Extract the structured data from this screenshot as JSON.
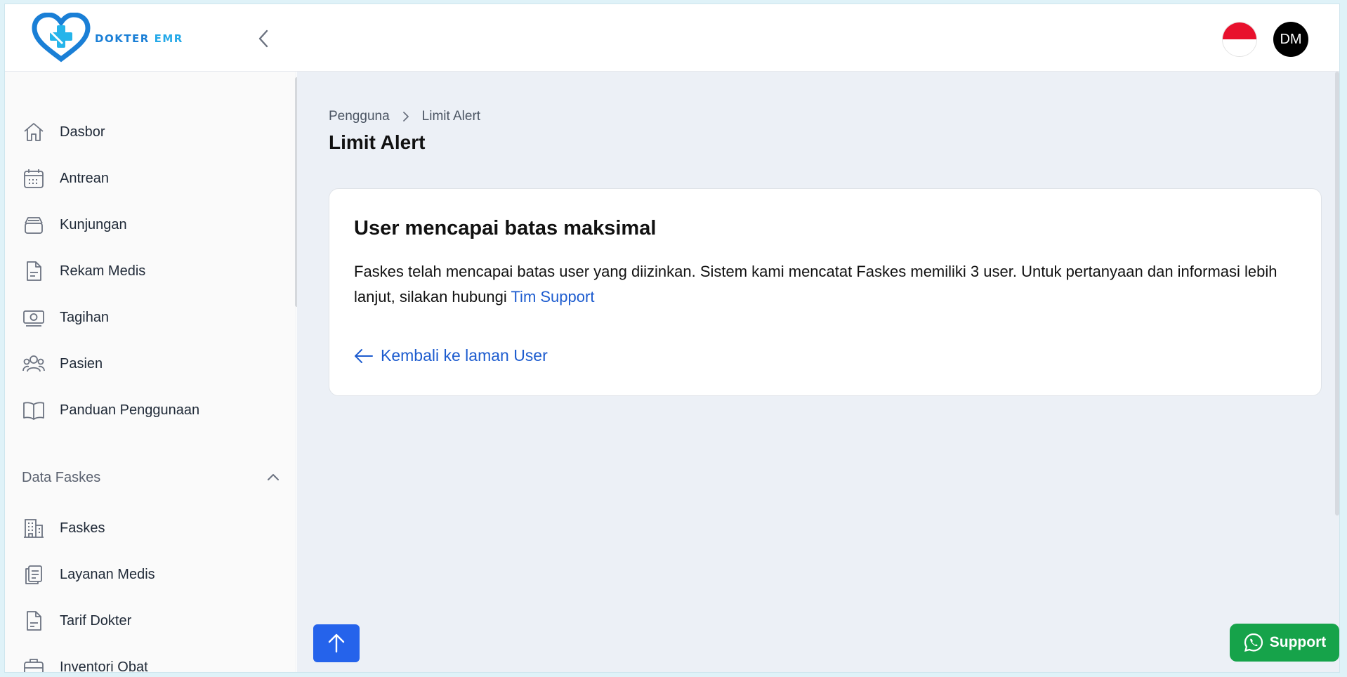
{
  "brand": {
    "name_part1": "DOKTER ",
    "name_part2": "EMR"
  },
  "header": {
    "avatar_initials": "DM"
  },
  "sidebar": {
    "items": [
      {
        "label": "Dasbor",
        "icon": "home-icon"
      },
      {
        "label": "Antrean",
        "icon": "calendar-icon"
      },
      {
        "label": "Kunjungan",
        "icon": "inbox-stack-icon"
      },
      {
        "label": "Rekam Medis",
        "icon": "document-icon"
      },
      {
        "label": "Tagihan",
        "icon": "money-icon"
      },
      {
        "label": "Pasien",
        "icon": "users-icon"
      },
      {
        "label": "Panduan Penggunaan",
        "icon": "book-icon"
      }
    ],
    "section": {
      "label": "Data Faskes",
      "items": [
        {
          "label": "Faskes",
          "icon": "building-icon"
        },
        {
          "label": "Layanan Medis",
          "icon": "clipboard-icon"
        },
        {
          "label": "Tarif Dokter",
          "icon": "document-text-icon"
        },
        {
          "label": "Inventori Obat",
          "icon": "briefcase-icon"
        }
      ]
    }
  },
  "breadcrumb": {
    "parent": "Pengguna",
    "current": "Limit Alert"
  },
  "page_title": "Limit Alert",
  "card": {
    "title": "User mencapai batas maksimal",
    "message": "Faskes telah mencapai batas user yang diizinkan. Sistem kami mencatat Faskes memiliki 3 user. Untuk pertanyaan dan informasi lebih lanjut, silakan hubungi ",
    "support_link": "Tim Support",
    "back_link": "Kembali ke laman User"
  },
  "support_button": "Support",
  "colors": {
    "primary": "#2563eb",
    "link": "#1d5ccf",
    "support": "#16a34a",
    "flag_red": "#e8112d"
  }
}
